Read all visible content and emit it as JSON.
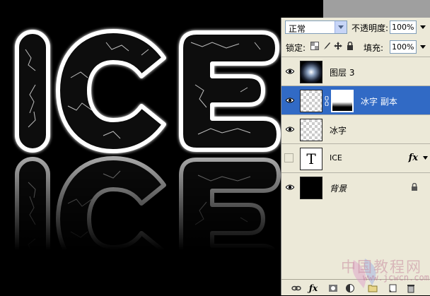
{
  "canvas": {
    "text": "ICE"
  },
  "panel": {
    "blend_mode": "正常",
    "opacity_label": "不透明度:",
    "opacity_value": "100%",
    "lock_label": "锁定:",
    "fill_label": "填充:",
    "fill_value": "100%",
    "layers": [
      {
        "name": "图层 3",
        "visible": true,
        "thumb": "radial-gradient-white"
      },
      {
        "name": "冰字 副本",
        "visible": true,
        "selected": true,
        "thumb": "checker",
        "has_mask": true
      },
      {
        "name": "冰字",
        "visible": true,
        "thumb": "checker"
      },
      {
        "name": "ICE",
        "visible": false,
        "thumb": "type-layer",
        "thumb_glyph": "T",
        "fx": "fx"
      },
      {
        "name": "背景",
        "visible": true,
        "thumb": "black",
        "locked": true
      }
    ]
  },
  "watermark": {
    "text": "中国教程网",
    "url": "www.jcwcn.com"
  },
  "icons": [
    "eye-icon",
    "lock-icon",
    "link-icon",
    "fx-icon",
    "mask-icon",
    "adjustment-icon",
    "folder-icon",
    "new-layer-icon",
    "trash-icon"
  ]
}
